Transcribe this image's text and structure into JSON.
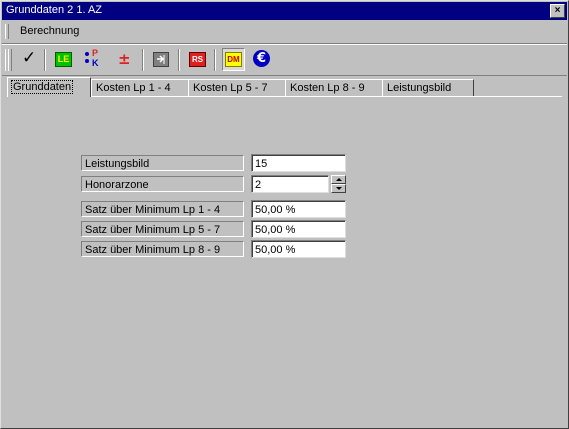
{
  "window": {
    "title": "Grunddaten 2 1. AZ",
    "close_label": "×"
  },
  "menu": {
    "items": [
      "Berechnung"
    ]
  },
  "toolbar": {
    "buttons": [
      {
        "icon": "checkmark-icon",
        "glyph": "✓"
      },
      {
        "icon": "le-icon",
        "glyph": "LE"
      },
      {
        "icon": "pk-icon",
        "glyph_top": "P",
        "glyph_bottom": "K"
      },
      {
        "icon": "plus-minus-icon",
        "glyph": "±"
      },
      {
        "icon": "import-icon",
        "glyph": ""
      },
      {
        "icon": "rs-icon",
        "glyph": "RS"
      },
      {
        "icon": "dm-icon",
        "glyph": "DM"
      },
      {
        "icon": "euro-icon",
        "glyph": "€"
      }
    ]
  },
  "tabs": [
    "Grunddaten",
    "Kosten Lp 1 - 4",
    "Kosten Lp 5 - 7",
    "Kosten Lp 8 - 9",
    "Leistungsbild"
  ],
  "form": {
    "rows": [
      {
        "label": "Leistungsbild",
        "value": "15"
      },
      {
        "label": "Honorarzone",
        "value": "2"
      },
      {
        "label": "Satz über Minimum Lp 1 - 4",
        "value": "50,00 %"
      },
      {
        "label": "Satz über Minimum Lp 5 - 7",
        "value": "50,00 %"
      },
      {
        "label": "Satz über Minimum Lp 8 - 9",
        "value": "50,00 %"
      }
    ]
  },
  "colors": {
    "titlebar": "#000080",
    "face": "#c0c0c0",
    "le_green": "#00c000",
    "rs_red": "#e02020",
    "dm_yellow": "#ffff00",
    "euro_blue": "#0000c0"
  }
}
